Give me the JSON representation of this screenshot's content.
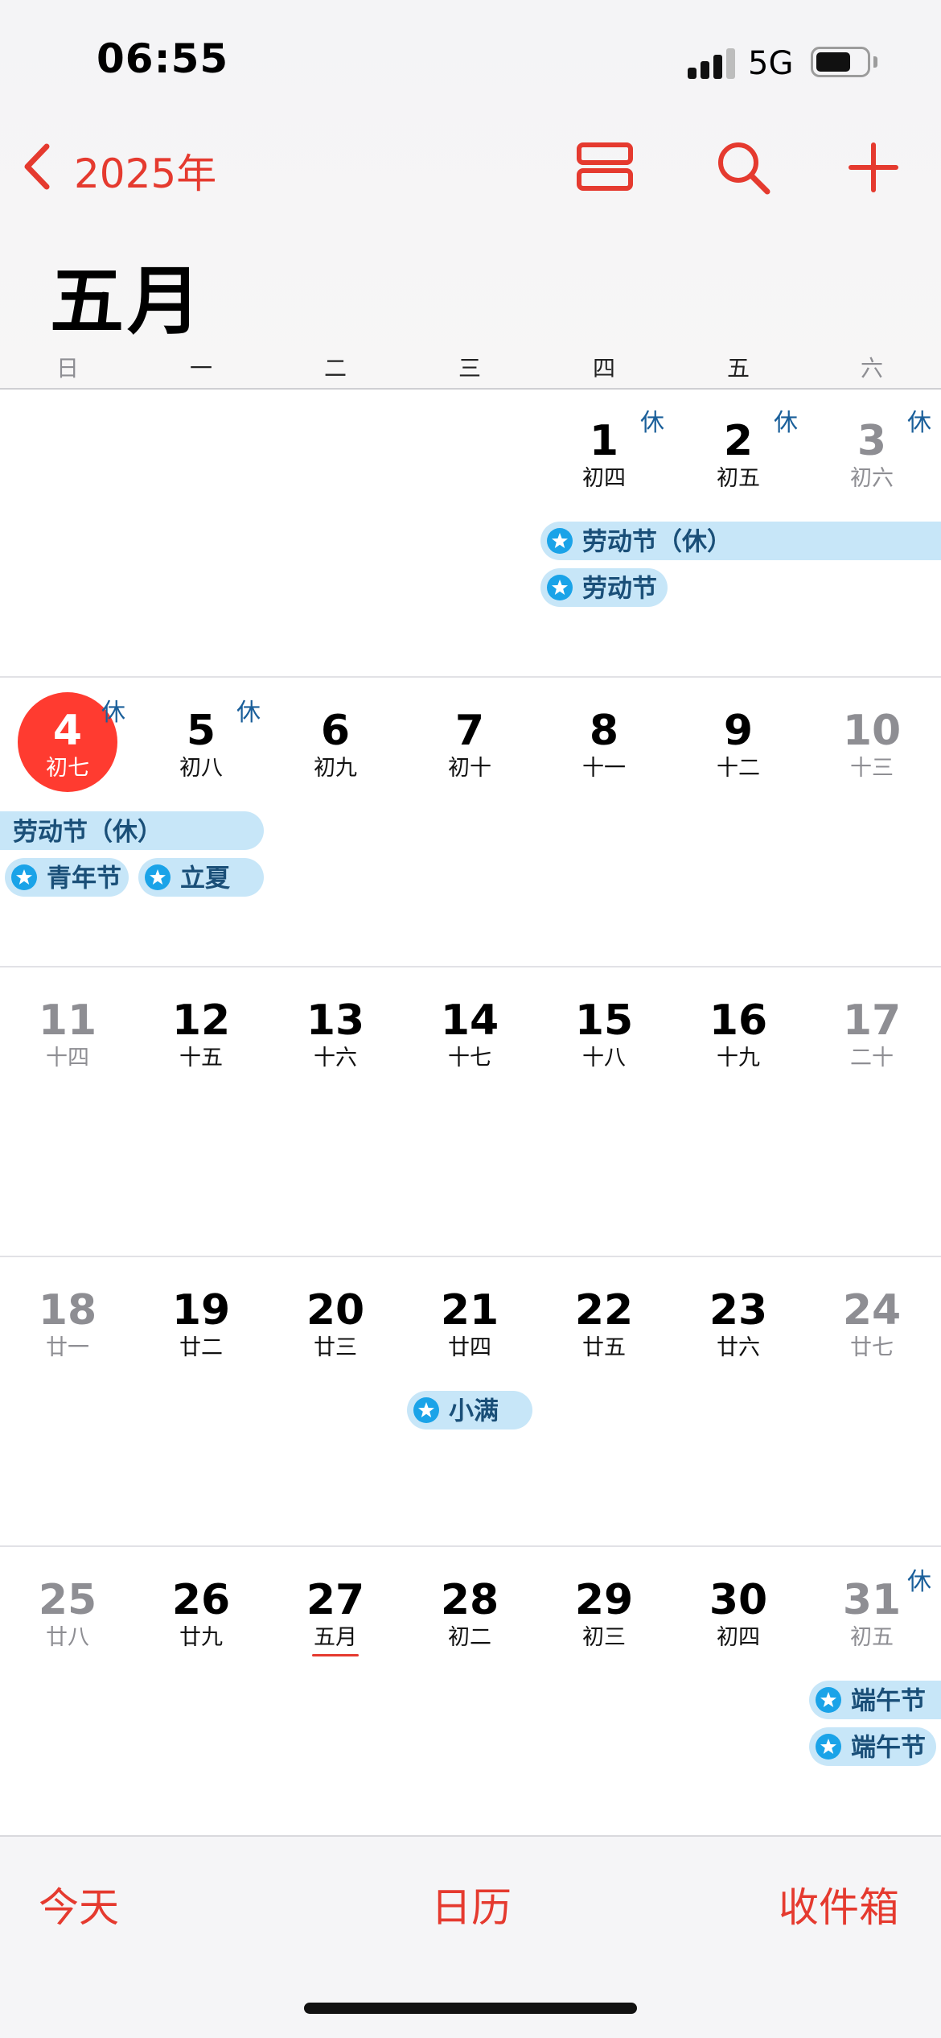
{
  "status_bar": {
    "time": "06:55",
    "network": "5G",
    "signal_bars": 3,
    "signal_bars_total": 4,
    "battery_level": 0.65
  },
  "nav": {
    "back_label": "2025年",
    "icons": [
      "list-view-icon",
      "search-icon",
      "add-icon"
    ]
  },
  "month_title": "五月",
  "weekdays": [
    "日",
    "一",
    "二",
    "三",
    "四",
    "五",
    "六"
  ],
  "rest_label": "休",
  "days": [
    {
      "num": "1",
      "lunar": "初四"
    },
    {
      "num": "2",
      "lunar": "初五"
    },
    {
      "num": "3",
      "lunar": "初六"
    },
    {
      "num": "4",
      "lunar": "初七"
    },
    {
      "num": "5",
      "lunar": "初八"
    },
    {
      "num": "6",
      "lunar": "初九"
    },
    {
      "num": "7",
      "lunar": "初十"
    },
    {
      "num": "8",
      "lunar": "十一"
    },
    {
      "num": "9",
      "lunar": "十二"
    },
    {
      "num": "10",
      "lunar": "十三"
    },
    {
      "num": "11",
      "lunar": "十四"
    },
    {
      "num": "12",
      "lunar": "十五"
    },
    {
      "num": "13",
      "lunar": "十六"
    },
    {
      "num": "14",
      "lunar": "十七"
    },
    {
      "num": "15",
      "lunar": "十八"
    },
    {
      "num": "16",
      "lunar": "十九"
    },
    {
      "num": "17",
      "lunar": "二十"
    },
    {
      "num": "18",
      "lunar": "廿一"
    },
    {
      "num": "19",
      "lunar": "廿二"
    },
    {
      "num": "20",
      "lunar": "廿三"
    },
    {
      "num": "21",
      "lunar": "廿四"
    },
    {
      "num": "22",
      "lunar": "廿五"
    },
    {
      "num": "23",
      "lunar": "廿六"
    },
    {
      "num": "24",
      "lunar": "廿七"
    },
    {
      "num": "25",
      "lunar": "廿八"
    },
    {
      "num": "26",
      "lunar": "廿九"
    },
    {
      "num": "27",
      "lunar": "五月"
    },
    {
      "num": "28",
      "lunar": "初二"
    },
    {
      "num": "29",
      "lunar": "初三"
    },
    {
      "num": "30",
      "lunar": "初四"
    },
    {
      "num": "31",
      "lunar": "初五"
    }
  ],
  "today": "4",
  "events": {
    "labor_day_rest": "劳动节（休）",
    "labor_day": "劳动节",
    "youth_day": "青年节",
    "lixia": "立夏",
    "xiaoman": "小满",
    "dragon_boat": "端午节"
  },
  "tabs": {
    "today": "今天",
    "calendars": "日历",
    "inbox": "收件箱"
  },
  "colors": {
    "accent": "#e53a2f",
    "today_circle": "#ff3b30",
    "event_bg": "#c7e6f8",
    "event_star": "#1aa3e8",
    "event_text": "#1a4f78"
  }
}
